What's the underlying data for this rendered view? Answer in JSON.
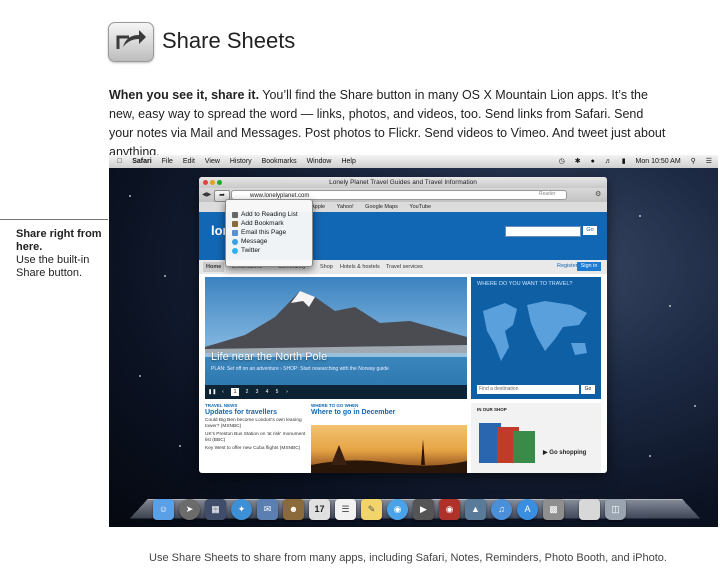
{
  "header": {
    "title": "Share Sheets",
    "icon": "share-icon"
  },
  "intro": {
    "lead": "When you see it, share it.",
    "body": " You’ll find the Share button in many OS X Mountain Lion apps. It’s the new, easy way to spread the word — links, photos, and videos, too. Send links from Safari. Send your notes via Mail and Messages. Post photos to Flickr. Send videos to Vimeo. And tweet just about anything."
  },
  "callout": {
    "heading": "Share right from here.",
    "body": "Use the built-in Share button."
  },
  "menubar": {
    "app": "Safari",
    "items": [
      "File",
      "Edit",
      "View",
      "History",
      "Bookmarks",
      "Window",
      "Help"
    ],
    "clock": "Mon 10:50 AM"
  },
  "browser": {
    "window_title": "Lonely Planet Travel Guides and Travel Information",
    "url": "www.lonelyplanet.com",
    "bookmarks": [
      "Apple",
      "Yahoo!",
      "Google Maps",
      "YouTube"
    ],
    "reader_label": "Reader"
  },
  "share_menu": {
    "items": [
      {
        "label": "Add to Reading List",
        "icon": "glasses-icon",
        "color": "#666666"
      },
      {
        "label": "Add Bookmark",
        "icon": "book-icon",
        "color": "#8a6a3a"
      },
      {
        "label": "Email this Page",
        "icon": "envelope-icon",
        "color": "#5b8fd0"
      },
      {
        "label": "Message",
        "icon": "speech-bubble-icon",
        "color": "#3aa0e0"
      },
      {
        "label": "Twitter",
        "icon": "bird-icon",
        "color": "#2fb2ec"
      }
    ]
  },
  "site": {
    "logo": "lonel",
    "search_go": "Go",
    "nav": [
      "Home",
      "Destinations",
      "Community",
      "Shop",
      "Hotels & hostels",
      "Travel services"
    ],
    "register": "Register",
    "signin": "Sign in",
    "hero": {
      "title": "Life near the North Pole",
      "subtitle": "PLAN: Set off on an adventure  ›  SHOP: Start researching with the Norway guide",
      "pages": [
        "1",
        "2",
        "3",
        "4",
        "5"
      ]
    },
    "map": {
      "title": "WHERE DO YOU WANT TO TRAVEL?",
      "placeholder": "Find a destination",
      "go": "Go"
    },
    "news": {
      "label": "TRAVEL NEWS",
      "title": "Updates for travellers",
      "items": [
        "Could Big Ben become London's own leaning tower? (MSNBC)",
        "UK's Preston Bus Station on 'at risk' monument list (BBC)",
        "Key West to offer new Cuba flights (MSNBC)"
      ]
    },
    "where": {
      "label": "WHERE TO GO WHEN",
      "title": "Where to go in December"
    },
    "shop": {
      "label": "IN OUR SHOP",
      "button": "Go shopping"
    }
  },
  "dock": {
    "icons": [
      {
        "name": "finder-icon",
        "color": "#5aa0e6"
      },
      {
        "name": "launchpad-icon",
        "color": "#6b6b6b"
      },
      {
        "name": "mission-control-icon",
        "color": "#3f4d6a"
      },
      {
        "name": "safari-icon",
        "color": "#3d8fd6"
      },
      {
        "name": "mail-icon",
        "color": "#5b7fb0"
      },
      {
        "name": "contacts-icon",
        "color": "#8a6a3a"
      },
      {
        "name": "calendar-icon",
        "color": "#e0e0e0"
      },
      {
        "name": "reminders-icon",
        "color": "#f2f2f2"
      },
      {
        "name": "notes-icon",
        "color": "#f1d46a"
      },
      {
        "name": "messages-icon",
        "color": "#4aa3e8"
      },
      {
        "name": "facetime-icon",
        "color": "#555555"
      },
      {
        "name": "photo-booth-icon",
        "color": "#b0302a"
      },
      {
        "name": "iphoto-icon",
        "color": "#5a7a9a"
      },
      {
        "name": "itunes-icon",
        "color": "#4a8fd8"
      },
      {
        "name": "app-store-icon",
        "color": "#3a8ee0"
      },
      {
        "name": "preview-icon",
        "color": "#8f8f8f"
      },
      {
        "name": "documents-stack-icon",
        "color": "#d8d8d8"
      },
      {
        "name": "trash-icon",
        "color": "#9aa4b0"
      }
    ],
    "calendar_day": "17"
  },
  "caption": "Use Share Sheets to share from many apps, including Safari, Notes, Reminders, Photo Booth, and iPhoto."
}
